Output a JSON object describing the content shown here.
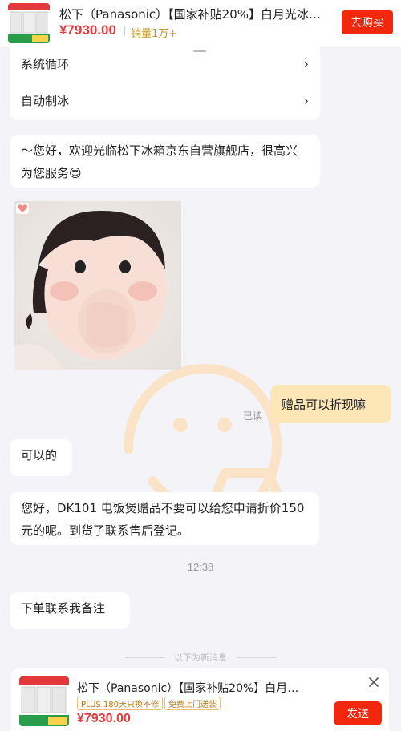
{
  "top_product": {
    "title": "松下（Panasonic）【国家补贴20%】白月光冰…",
    "price": "¥7930.00",
    "sales": "销量1万+",
    "buy_label": "去购买"
  },
  "menu": {
    "items": [
      {
        "label": "系统循环",
        "chevron": "›"
      },
      {
        "label": "自动制冰",
        "chevron": "›"
      }
    ]
  },
  "messages": {
    "welcome": "～您好，欢迎光临松下冰箱京东自营旗舰店，很高兴为您服务😍",
    "user_question": "赠品可以折现嘛",
    "read_status": "已读",
    "reply_ok": "可以的",
    "reply_detail": "您好，DK101 电饭煲赠品不要可以给您申请折价150元的呢。到货了联系售后登记。",
    "time": "12:38",
    "reply_note": "下单联系我备注"
  },
  "divider": {
    "text": "以下为新消息"
  },
  "bottom_product": {
    "title": "松下（Panasonic）【国家补贴20%】白月…",
    "tags": [
      "PLUS 180天只换不修",
      "免费上门送装"
    ],
    "price": "¥7930.00",
    "send_label": "发送"
  },
  "colors": {
    "accent_red": "#f2270c",
    "price_red": "#e4393c",
    "bubble_user": "#fde6b5",
    "background": "#f4f4f8"
  },
  "icons": {
    "watermark": "smiley-watermark-icon",
    "close": "close-icon",
    "chevron": "chevron-right-icon"
  }
}
